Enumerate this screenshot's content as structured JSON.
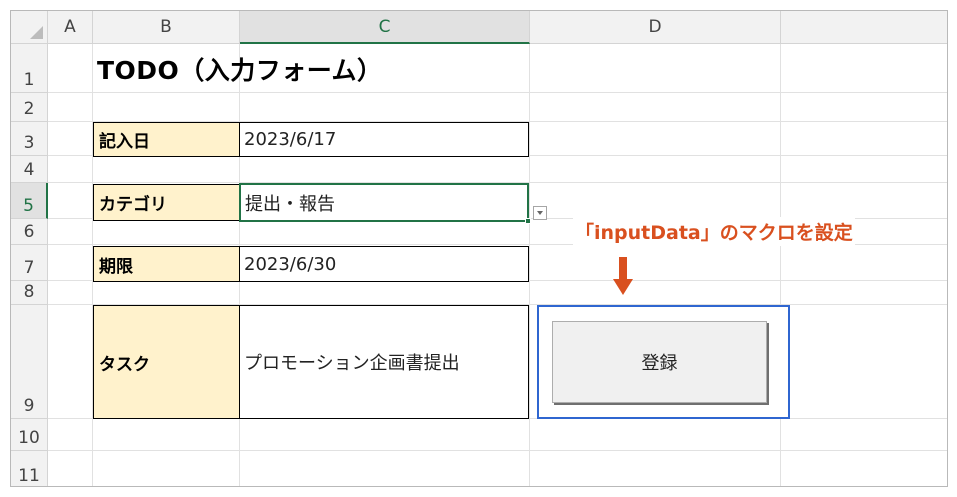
{
  "sheet": {
    "columns": [
      "A",
      "B",
      "C",
      "D"
    ],
    "selected_column": "C",
    "rows": [
      "1",
      "2",
      "3",
      "4",
      "5",
      "6",
      "7",
      "8",
      "9",
      "10",
      "11"
    ],
    "selected_row": "5"
  },
  "form": {
    "title": "TODO（入力フォーム）",
    "fields": [
      {
        "label": "記入日",
        "value": "2023/6/17"
      },
      {
        "label": "カテゴリ",
        "value": "提出・報告"
      },
      {
        "label": "期限",
        "value": "2023/6/30"
      },
      {
        "label": "タスク",
        "value": "プロモーション企画書提出"
      }
    ],
    "dropdown_icon": "chevron-down-icon"
  },
  "annotation": {
    "text": "「inputData」のマクロを設定",
    "color": "#d9501f",
    "arrow_icon": "arrow-down-icon"
  },
  "button": {
    "label": "登録",
    "frame_color": "#2f66d0"
  },
  "colors": {
    "label_fill": "#fff2cc",
    "selection": "#217346"
  }
}
